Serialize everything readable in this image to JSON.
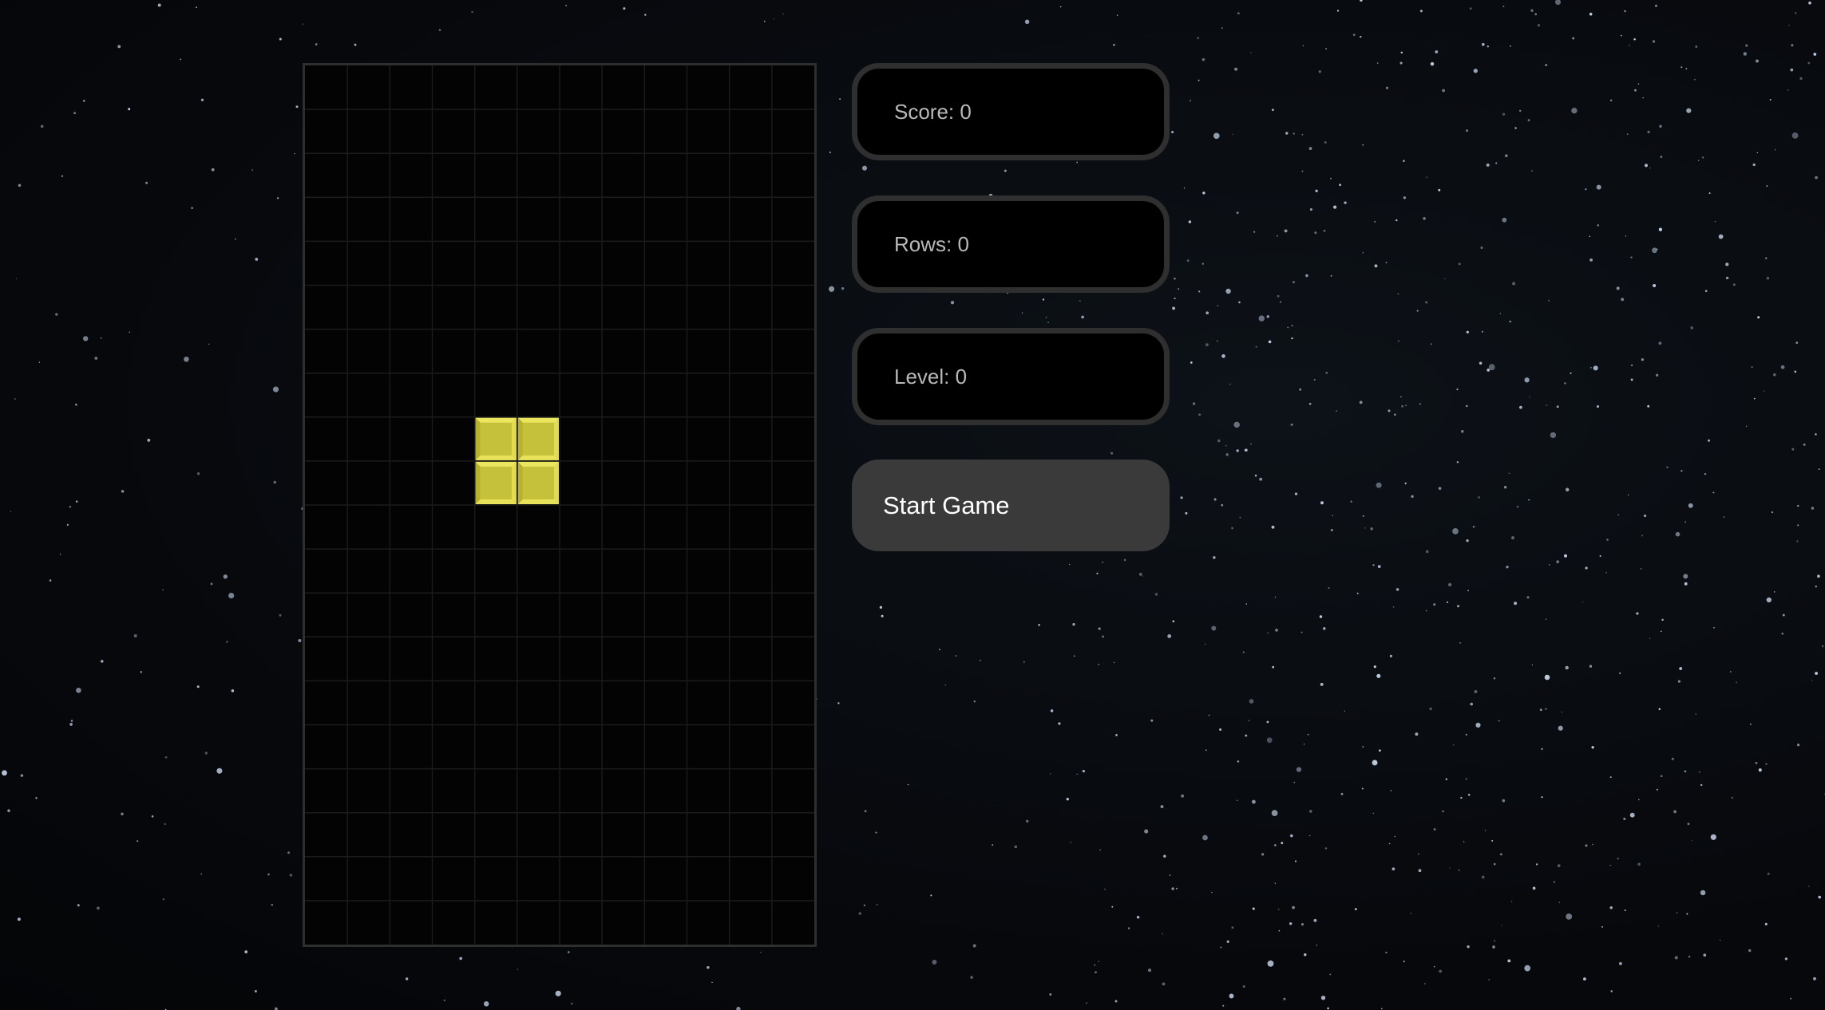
{
  "stats": {
    "score": "Score: 0",
    "rows": "Rows: 0",
    "level": "Level: 0"
  },
  "controls": {
    "start_label": "Start Game"
  },
  "board": {
    "columns": 12,
    "rows": 20,
    "active_piece": {
      "shape": "O",
      "color": "#c6c13a",
      "cells": [
        [
          4,
          8
        ],
        [
          5,
          8
        ],
        [
          4,
          9
        ],
        [
          5,
          9
        ]
      ]
    }
  },
  "colors": {
    "board_background": "#030303",
    "grid_line": "#1b1b1b",
    "panel_border": "#2f2f2f",
    "button_background": "#3a3a3a",
    "stat_text": "#b9b9b9"
  }
}
